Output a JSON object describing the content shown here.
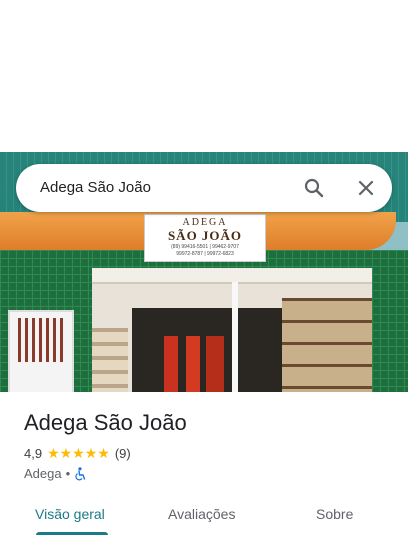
{
  "search": {
    "query": "Adega São João"
  },
  "photo": {
    "sign_line1": "ADEGA",
    "sign_line2": "SÃO JOÃO",
    "sign_phones1": "(89) 99416-5501 | 99462-9707",
    "sign_phones2": "99972-8787 | 99972-6823"
  },
  "place": {
    "name": "Adega São João",
    "rating": "4,9",
    "stars": "★★★★★",
    "review_count": "(9)",
    "category": "Adega",
    "separator": "•"
  },
  "tabs": [
    {
      "label": "Visão geral",
      "active": true
    },
    {
      "label": "Avaliações",
      "active": false
    },
    {
      "label": "Sobre",
      "active": false
    }
  ],
  "colors": {
    "accent": "#1a7a88",
    "star": "#fbbc04",
    "text": "#202124"
  }
}
